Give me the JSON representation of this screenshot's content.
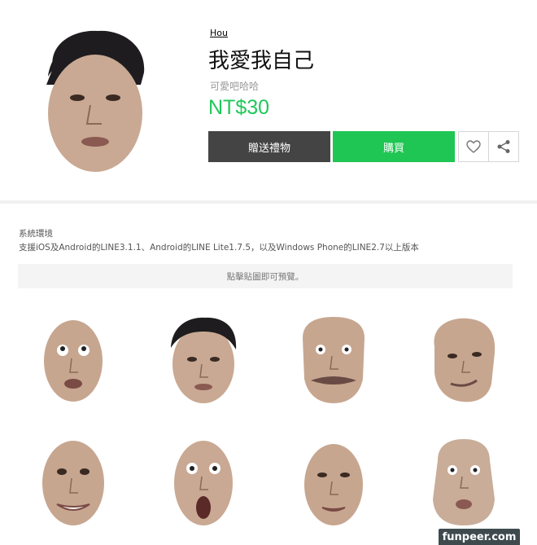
{
  "product": {
    "author": "Hou",
    "title": "我愛我自己",
    "subtitle": "可愛吧哈哈",
    "price": "NT$30"
  },
  "actions": {
    "gift_label": "贈送禮物",
    "buy_label": "購買",
    "favorite_icon": "heart-icon",
    "share_icon": "share-icon"
  },
  "requirements": {
    "heading": "系統環境",
    "text": "支援iOS及Android的LINE3.1.1、Android的LINE Lite1.7.5，以及Windows Phone的LINE2.7以上版本"
  },
  "preview": {
    "hint": "點擊貼圖即可預覽。"
  },
  "stickers": [
    {
      "name": "sticker-1"
    },
    {
      "name": "sticker-2"
    },
    {
      "name": "sticker-3"
    },
    {
      "name": "sticker-4"
    },
    {
      "name": "sticker-5"
    },
    {
      "name": "sticker-6"
    },
    {
      "name": "sticker-7"
    },
    {
      "name": "sticker-8"
    }
  ],
  "watermark": "funpeer.com",
  "colors": {
    "price_green": "#1ec85a",
    "buy_button": "#1fc653",
    "gift_button": "#444444"
  }
}
